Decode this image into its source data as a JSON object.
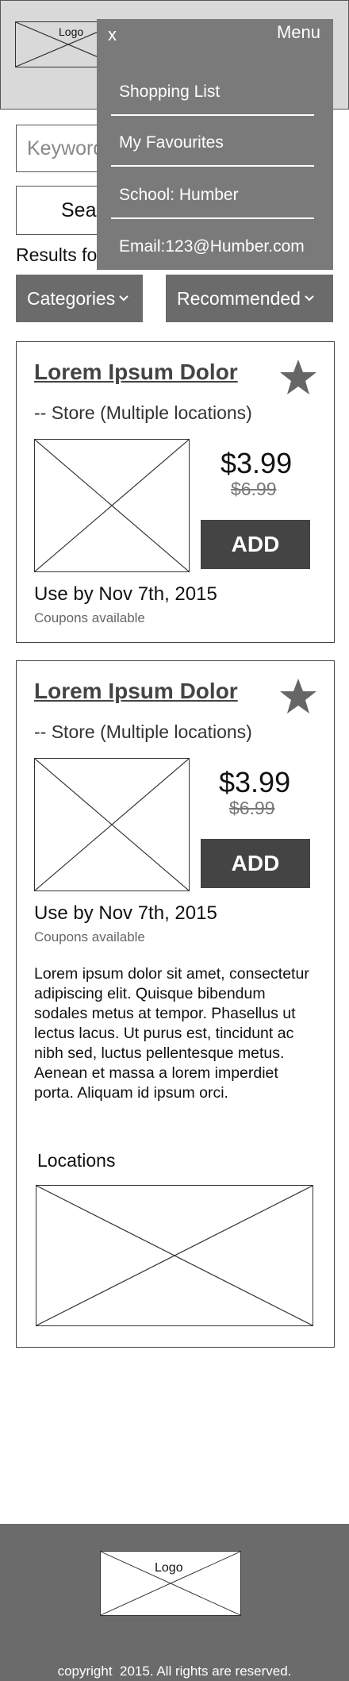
{
  "header": {
    "logo_label": "Logo"
  },
  "search": {
    "placeholder": "Keywords",
    "button_label": "Search",
    "results_label": "Results for"
  },
  "filters": {
    "categories_label": "Categories",
    "recommended_label": "Recommended"
  },
  "menu": {
    "close_label": "x",
    "title": "Menu",
    "items": [
      {
        "label": "Shopping List"
      },
      {
        "label": "My Favourites"
      },
      {
        "label": "School: Humber"
      },
      {
        "label": "Email:123@Humber.com"
      }
    ]
  },
  "products": [
    {
      "title": "Lorem Ipsum Dolor",
      "store": "-- Store (Multiple locations)",
      "price": "$3.99",
      "old_price": "$6.99",
      "add_label": "ADD",
      "use_by": "Use by Nov 7th, 2015",
      "coupons": "Coupons available"
    },
    {
      "title": "Lorem Ipsum Dolor",
      "store": "-- Store (Multiple locations)",
      "price": "$3.99",
      "old_price": "$6.99",
      "add_label": "ADD",
      "use_by": "Use by Nov 7th, 2015",
      "coupons": "Coupons available",
      "description": "Lorem ipsum dolor sit amet, consectetur adipiscing elit. Quisque bibendum sodales metus at tempor. Phasellus ut lectus lacus. Ut purus est, tincidunt ac nibh sed, luctus pellentesque metus. Aenean et massa a lorem imperdiet porta. Aliquam id ipsum orci.",
      "locations_label": "Locations"
    }
  ],
  "footer": {
    "logo_label": "Logo",
    "copyright": "copyright  2015. All rights are reserved."
  },
  "colors": {
    "menu_bg": "#7a7a7a",
    "dropdown_bg": "#6b6b6b",
    "add_button": "#444444",
    "footer_bg": "#6b6b6b"
  },
  "icons": [
    "close-icon",
    "star-icon",
    "chevron-down-icon"
  ]
}
